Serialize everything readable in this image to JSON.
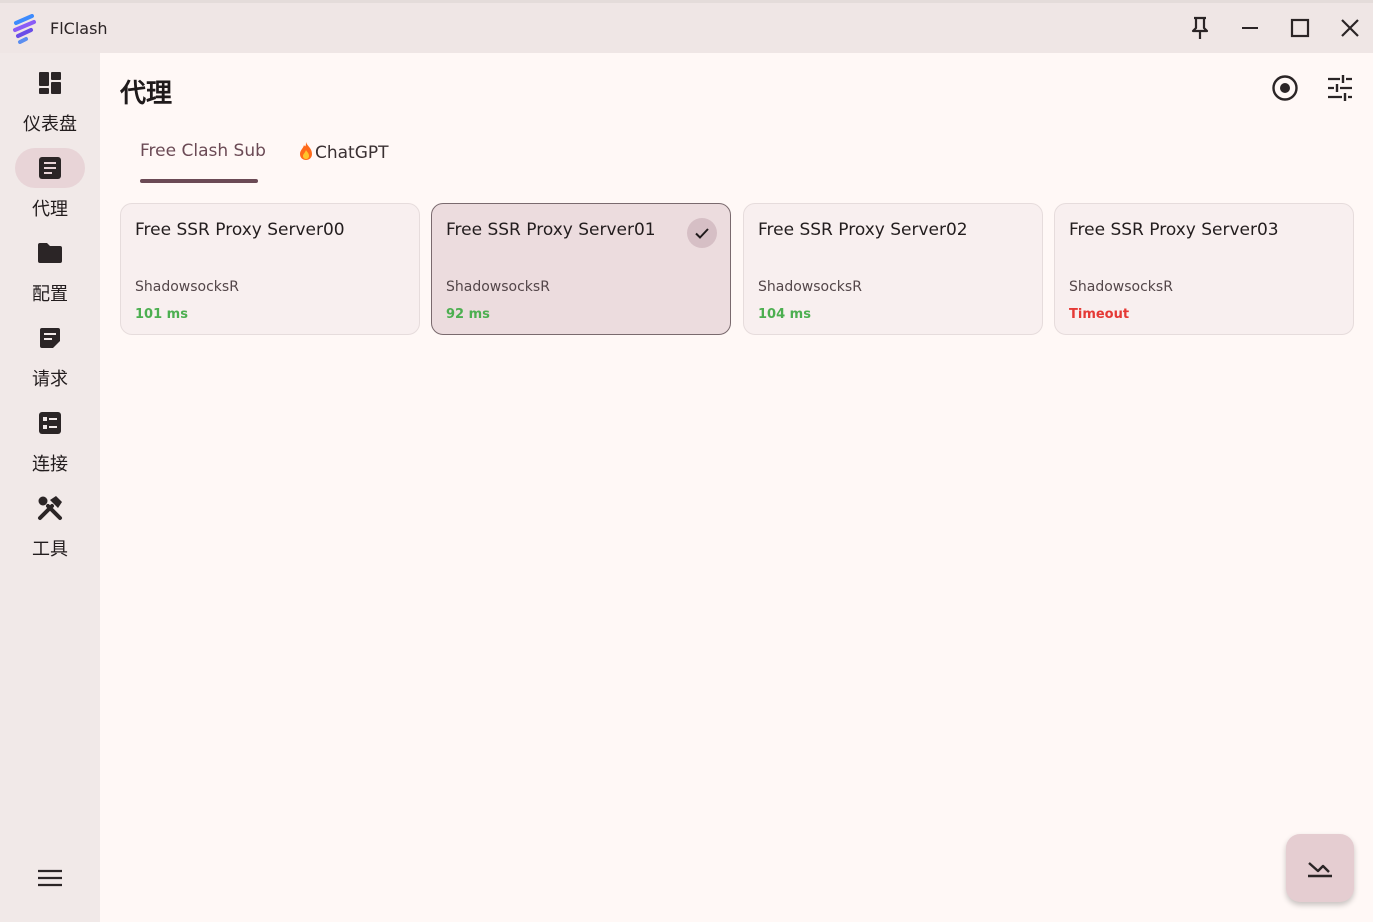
{
  "window": {
    "title": "FlClash",
    "buttons": [
      "pin-icon",
      "minimize-icon",
      "maximize-icon",
      "close-icon"
    ]
  },
  "sidebar": {
    "items": [
      {
        "label": "仪表盘",
        "icon": "dashboard-icon",
        "active": false
      },
      {
        "label": "代理",
        "icon": "article-icon",
        "active": true
      },
      {
        "label": "配置",
        "icon": "folder-icon",
        "active": false
      },
      {
        "label": "请求",
        "icon": "notes-icon",
        "active": false
      },
      {
        "label": "连接",
        "icon": "list-alt-icon",
        "active": false
      },
      {
        "label": "工具",
        "icon": "tools-icon",
        "active": false
      }
    ],
    "menu_icon": "hamburger-menu-icon"
  },
  "main": {
    "title": "代理",
    "header_icons": [
      "radio-target-icon",
      "tune-icon"
    ],
    "tabs": [
      {
        "label": "Free Clash Sub",
        "active": true
      },
      {
        "label": "ChatGPT",
        "prefix_icon": "fire-icon",
        "active": false
      }
    ],
    "proxies": [
      {
        "name": "Free SSR Proxy Server00",
        "type": "ShadowsocksR",
        "delay": "101 ms",
        "status": "ok",
        "selected": false
      },
      {
        "name": "Free SSR Proxy Server01",
        "type": "ShadowsocksR",
        "delay": "92 ms",
        "status": "ok",
        "selected": true
      },
      {
        "name": "Free SSR Proxy Server02",
        "type": "ShadowsocksR",
        "delay": "104 ms",
        "status": "ok",
        "selected": false
      },
      {
        "name": "Free SSR Proxy Server03",
        "type": "ShadowsocksR",
        "delay": "Timeout",
        "status": "timeout",
        "selected": false
      }
    ],
    "fab_icon": "test-delay-icon"
  },
  "colors": {
    "accent": "#6b4a55",
    "delay_ok": "#4caf50",
    "delay_timeout": "#e53935",
    "selected_card": "#ecdcde"
  }
}
